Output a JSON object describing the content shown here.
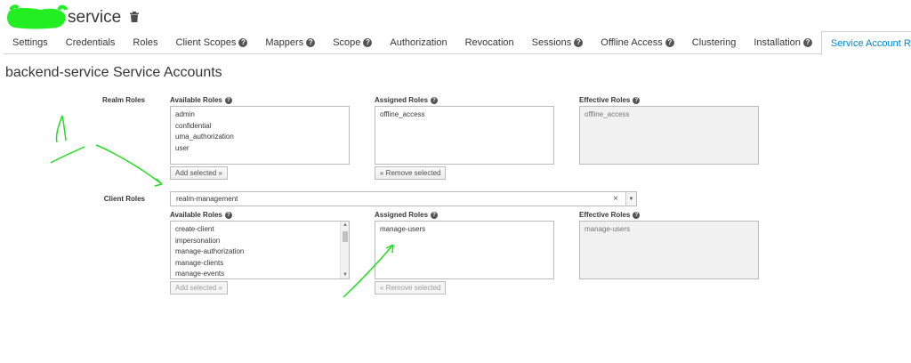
{
  "header": {
    "client_name": "service"
  },
  "tabs": [
    {
      "label": "Settings",
      "help": false
    },
    {
      "label": "Credentials",
      "help": false
    },
    {
      "label": "Roles",
      "help": false
    },
    {
      "label": "Client Scopes",
      "help": true
    },
    {
      "label": "Mappers",
      "help": true
    },
    {
      "label": "Scope",
      "help": true
    },
    {
      "label": "Authorization",
      "help": false
    },
    {
      "label": "Revocation",
      "help": false
    },
    {
      "label": "Sessions",
      "help": true
    },
    {
      "label": "Offline Access",
      "help": true
    },
    {
      "label": "Clustering",
      "help": false
    },
    {
      "label": "Installation",
      "help": true
    },
    {
      "label": "Service Account Roles",
      "help": true
    }
  ],
  "page_title": "backend-service Service Accounts",
  "realm_roles": {
    "label": "Realm Roles",
    "available_label": "Available Roles",
    "assigned_label": "Assigned Roles",
    "effective_label": "Effective Roles",
    "available": [
      "admin",
      "confidential",
      "uma_authorization",
      "user"
    ],
    "assigned": [
      "offline_access"
    ],
    "effective": [
      "offline_access"
    ],
    "add_button": "Add selected »",
    "remove_button": "« Remove selected"
  },
  "client_roles": {
    "label": "Client Roles",
    "selected_client": "realm-management",
    "clear_symbol": "×",
    "caret_symbol": "▼",
    "available_label": "Available Roles",
    "assigned_label": "Assigned Roles",
    "effective_label": "Effective Roles",
    "available": [
      "create-client",
      "impersonation",
      "manage-authorization",
      "manage-clients",
      "manage-events"
    ],
    "assigned": [
      "manage-users"
    ],
    "effective": [
      "manage-users"
    ],
    "add_button": "Add selected »",
    "remove_button": "« Remove selected"
  },
  "colors": {
    "active_tab": "#0088ce",
    "annotation_green": "#22dd22",
    "redaction_green": "#22ee22"
  },
  "icons": {
    "delete": "trash-icon",
    "help": "question-circle-icon",
    "clear": "clear-icon",
    "dropdown": "caret-down-icon"
  }
}
